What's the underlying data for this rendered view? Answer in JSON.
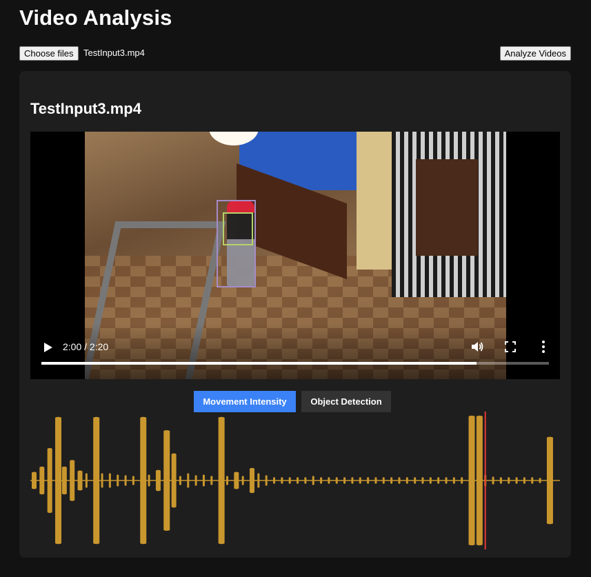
{
  "page": {
    "title": "Video Analysis"
  },
  "toolbar": {
    "choose_files_label": "Choose files",
    "selected_file": "TestInput3.mp4",
    "analyze_label": "Analyze Videos"
  },
  "card": {
    "title": "TestInput3.mp4"
  },
  "video": {
    "time_display": "2:00 / 2:20",
    "progress_fraction": 0.857
  },
  "tabs": [
    {
      "label": "Movement Intensity",
      "active": true
    },
    {
      "label": "Object Detection",
      "active": false
    }
  ],
  "colors": {
    "waveform": "#c9972e",
    "playhead": "#e53935",
    "active_tab": "#3b82f6",
    "inactive_tab": "#333333"
  },
  "waveform": {
    "playhead_fraction": 0.859,
    "segments": [
      {
        "at": 0.0,
        "amp": 0.12
      },
      {
        "at": 0.015,
        "amp": 0.2
      },
      {
        "at": 0.03,
        "amp": 0.48
      },
      {
        "at": 0.045,
        "amp": 0.95
      },
      {
        "at": 0.058,
        "amp": 0.2
      },
      {
        "at": 0.073,
        "amp": 0.3
      },
      {
        "at": 0.088,
        "amp": 0.14
      },
      {
        "at": 0.103,
        "amp": 0.1
      },
      {
        "at": 0.118,
        "amp": 0.95
      },
      {
        "at": 0.133,
        "amp": 0.1
      },
      {
        "at": 0.148,
        "amp": 0.1
      },
      {
        "at": 0.163,
        "amp": 0.08
      },
      {
        "at": 0.178,
        "amp": 0.07
      },
      {
        "at": 0.193,
        "amp": 0.06
      },
      {
        "at": 0.208,
        "amp": 0.95
      },
      {
        "at": 0.223,
        "amp": 0.08
      },
      {
        "at": 0.238,
        "amp": 0.15
      },
      {
        "at": 0.253,
        "amp": 0.75
      },
      {
        "at": 0.268,
        "amp": 0.4
      },
      {
        "at": 0.283,
        "amp": 0.06
      },
      {
        "at": 0.298,
        "amp": 0.1
      },
      {
        "at": 0.313,
        "amp": 0.07
      },
      {
        "at": 0.328,
        "amp": 0.08
      },
      {
        "at": 0.343,
        "amp": 0.06
      },
      {
        "at": 0.358,
        "amp": 0.95
      },
      {
        "at": 0.373,
        "amp": 0.06
      },
      {
        "at": 0.388,
        "amp": 0.12
      },
      {
        "at": 0.403,
        "amp": 0.06
      },
      {
        "at": 0.418,
        "amp": 0.18
      },
      {
        "at": 0.433,
        "amp": 0.1
      },
      {
        "at": 0.448,
        "amp": 0.07
      },
      {
        "at": 0.463,
        "amp": 0.04
      },
      {
        "at": 0.478,
        "amp": 0.04
      },
      {
        "at": 0.493,
        "amp": 0.04
      },
      {
        "at": 0.508,
        "amp": 0.04
      },
      {
        "at": 0.523,
        "amp": 0.04
      },
      {
        "at": 0.538,
        "amp": 0.06
      },
      {
        "at": 0.553,
        "amp": 0.04
      },
      {
        "at": 0.568,
        "amp": 0.04
      },
      {
        "at": 0.583,
        "amp": 0.04
      },
      {
        "at": 0.598,
        "amp": 0.04
      },
      {
        "at": 0.613,
        "amp": 0.04
      },
      {
        "at": 0.628,
        "amp": 0.04
      },
      {
        "at": 0.643,
        "amp": 0.04
      },
      {
        "at": 0.658,
        "amp": 0.04
      },
      {
        "at": 0.673,
        "amp": 0.04
      },
      {
        "at": 0.688,
        "amp": 0.04
      },
      {
        "at": 0.703,
        "amp": 0.04
      },
      {
        "at": 0.718,
        "amp": 0.04
      },
      {
        "at": 0.733,
        "amp": 0.04
      },
      {
        "at": 0.748,
        "amp": 0.04
      },
      {
        "at": 0.763,
        "amp": 0.04
      },
      {
        "at": 0.778,
        "amp": 0.04
      },
      {
        "at": 0.793,
        "amp": 0.04
      },
      {
        "at": 0.808,
        "amp": 0.04
      },
      {
        "at": 0.823,
        "amp": 0.04
      },
      {
        "at": 0.838,
        "amp": 0.97
      },
      {
        "at": 0.853,
        "amp": 0.97
      },
      {
        "at": 0.868,
        "amp": 0.08
      },
      {
        "at": 0.883,
        "amp": 0.05
      },
      {
        "at": 0.898,
        "amp": 0.04
      },
      {
        "at": 0.913,
        "amp": 0.04
      },
      {
        "at": 0.928,
        "amp": 0.04
      },
      {
        "at": 0.943,
        "amp": 0.04
      },
      {
        "at": 0.958,
        "amp": 0.04
      },
      {
        "at": 0.973,
        "amp": 0.03
      },
      {
        "at": 0.988,
        "amp": 0.65
      }
    ]
  }
}
